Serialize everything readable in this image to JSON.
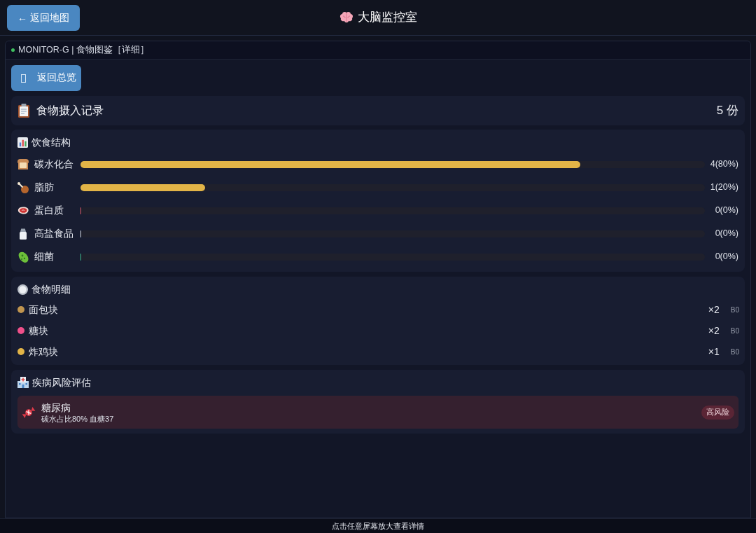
{
  "header": {
    "back_button": "← 返回地图",
    "title": "大脑监控室"
  },
  "breadcrumb": "MONITOR-G | 食物图鉴［详细］",
  "overview_button": "返回总览",
  "intake_summary": {
    "title": "食物摄入记录",
    "count": "5 份"
  },
  "diet_structure": {
    "title": "饮食结构",
    "rows": [
      {
        "kind": "bread",
        "label": "碳水化合",
        "level": 0.8,
        "reading": "4(80%)",
        "color": "#e2b447"
      },
      {
        "kind": "drumstick",
        "label": "脂肪",
        "level": 0.2,
        "reading": "1(20%)",
        "color": "#e2b447"
      },
      {
        "kind": "meat",
        "label": "蛋白质",
        "level": 0,
        "reading": "0(0%)",
        "color": "#e05a6a"
      },
      {
        "kind": "salt",
        "label": "高盐食品",
        "level": 0,
        "reading": "0(0%)",
        "color": "#d8dce4"
      },
      {
        "kind": "microbe",
        "label": "细菌",
        "level": 0,
        "reading": "0(0%)",
        "color": "#3fbf8f"
      }
    ]
  },
  "food_details": {
    "title": "食物明细",
    "items": [
      {
        "name": "面包块",
        "color": "#c0954f",
        "count": "×2",
        "code": "B0"
      },
      {
        "name": "糖块",
        "color": "#f0508a",
        "count": "×2",
        "code": "B0"
      },
      {
        "name": "炸鸡块",
        "color": "#e2b447",
        "count": "×1",
        "code": "B0"
      }
    ]
  },
  "risk_assessment": {
    "title": "疾病风险评估",
    "items": [
      {
        "name": "糖尿病",
        "detail": "碳水占比80% 血糖37",
        "badge": "高风险"
      }
    ]
  },
  "footer": {
    "hint": "点击任意屏幕放大查看详情"
  }
}
